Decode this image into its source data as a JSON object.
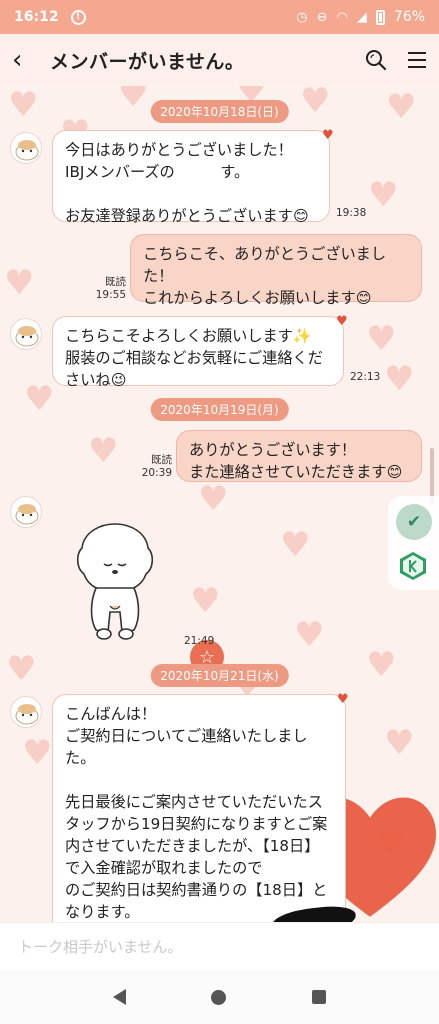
{
  "status_bar": {
    "time": "16:12",
    "battery": "76%"
  },
  "header": {
    "title": "メンバーがいません。"
  },
  "dates": [
    "2020年10月18日(日)",
    "2020年10月19日(月)",
    "2020年10月21日(水)"
  ],
  "messages": [
    {
      "text": "今日はありがとうございました！\nIBJメンバーズの　　　す。\n\nお友達登録ありがとうございます😊",
      "time": "19:38"
    },
    {
      "text": "こちらこそ、ありがとうございまし\nた！\nこれからよろしくお願いします😊",
      "read": "既読",
      "time": "19:55"
    },
    {
      "text": "こちらこそよろしくお願いします✨\n服装のご相談などお気軽にご連絡くだ\nさいね😉",
      "time": "22:13"
    },
    {
      "text": "ありがとうございます！\nまた連絡させていただきます😊",
      "read": "既読",
      "time": "20:39"
    },
    {
      "time": "21:49"
    },
    {
      "text": "こんばんは！\nご契約日についてご連絡いたしまし\nた。\n\n先日最後にご案内させていただいたス\nタッフから19日契約になりますとご案\n内させていただきましたが、【18日】\nで入金確認が取れましたので\nのご契約日は契約書通りの【18日】と\nなります。\nそれに伴い、カウンセリング時に契約\n書、概要書面はお持ちいただかなくて"
    }
  ],
  "input": {
    "placeholder": "トーク相手がいません。"
  },
  "colors": {
    "accent": "#ee6b4d",
    "status_bar": "#f3a88f",
    "date_pill": "#ee9a82",
    "bubble_out": "#f9d5c8"
  }
}
